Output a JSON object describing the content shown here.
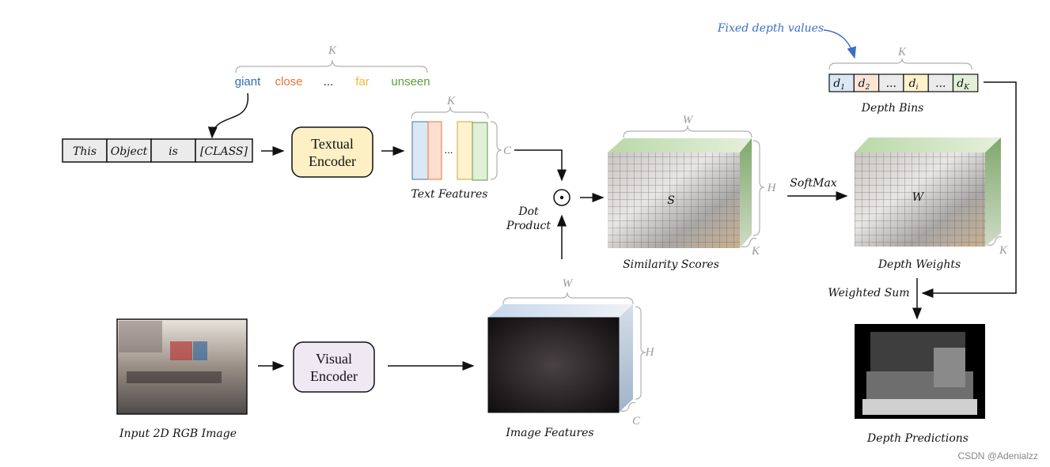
{
  "prompt": {
    "tokens": [
      "This",
      "Object",
      "is",
      "[CLASS]"
    ],
    "k_label": "K",
    "words": [
      {
        "text": "giant",
        "color": "#2e6db4"
      },
      {
        "text": "close",
        "color": "#e8743b"
      },
      {
        "text": "...",
        "color": "#222222"
      },
      {
        "text": "far",
        "color": "#f5b731"
      },
      {
        "text": "unseen",
        "color": "#5a9e3f"
      }
    ]
  },
  "textual_encoder": {
    "line1": "Textual",
    "line2": "Encoder",
    "fill": "#fdf0c4"
  },
  "text_features": {
    "caption": "Text Features",
    "k_label": "K",
    "c_label": "C",
    "ellipsis": "..."
  },
  "dot_product": {
    "line1": "Dot",
    "line2": "Product"
  },
  "similarity": {
    "caption": "Similarity Scores",
    "symbol": "S",
    "w_label": "W",
    "h_label": "H",
    "k_label": "K"
  },
  "softmax": {
    "label": "SoftMax"
  },
  "depth_weights": {
    "caption": "Depth Weights",
    "symbol": "W",
    "k_label": "K"
  },
  "depth_bins": {
    "caption": "Depth Bins",
    "annotation": "Fixed depth values",
    "k_label": "K",
    "cells": [
      {
        "main": "d",
        "sub": "1",
        "fill": "#dae8f5"
      },
      {
        "main": "d",
        "sub": "2",
        "fill": "#fbe5d6"
      },
      {
        "main": "...",
        "sub": "",
        "fill": "#ebebeb"
      },
      {
        "main": "d",
        "sub": "i",
        "fill": "#fff2cc"
      },
      {
        "main": "...",
        "sub": "",
        "fill": "#ebebeb"
      },
      {
        "main": "d",
        "sub": "K",
        "fill": "#e2efd9"
      }
    ]
  },
  "weighted_sum": {
    "label": "Weighted Sum"
  },
  "depth_predictions": {
    "caption": "Depth Predictions"
  },
  "input_image": {
    "caption": "Input 2D RGB Image"
  },
  "visual_encoder": {
    "line1": "Visual",
    "line2": "Encoder",
    "fill": "#efe9f4"
  },
  "image_features": {
    "caption": "Image Features",
    "w_label": "W",
    "h_label": "H",
    "c_label": "C"
  },
  "watermark": "CSDN @Adenialzz",
  "colors": {
    "annotation": "#3a6fc4",
    "green_cube": "#8fb87f",
    "blue_cube": "#b7c9dc"
  }
}
